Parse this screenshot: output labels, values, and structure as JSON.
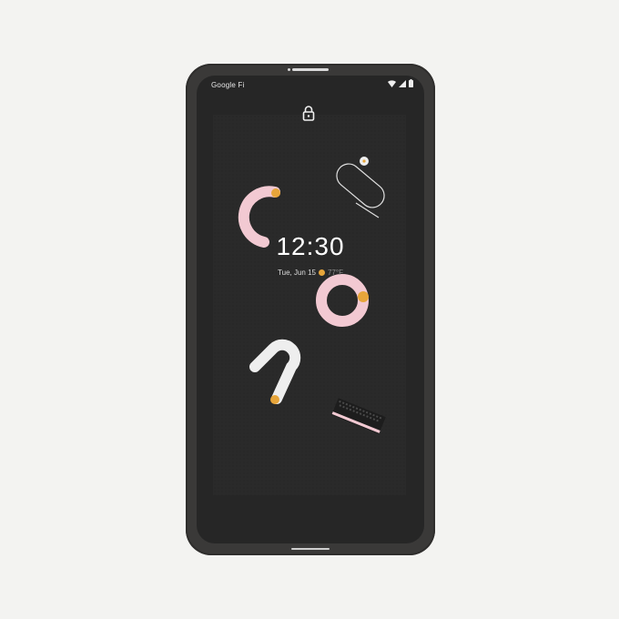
{
  "status_bar": {
    "carrier": "Google Fi",
    "wifi_icon": "wifi-icon",
    "signal_icon": "signal-icon",
    "battery_icon": "battery-icon"
  },
  "lock_screen": {
    "lock_icon": "lock-icon",
    "time": "12:30",
    "date": "Tue, Jun 15",
    "weather_icon": "sun-icon",
    "temperature": "77°F"
  },
  "colors": {
    "phone_body": "#3a3938",
    "screen_bg": "#262626",
    "accent_orange": "#e7a53a",
    "pink": "#f2c9d2",
    "white_shape": "#eeeeee"
  }
}
